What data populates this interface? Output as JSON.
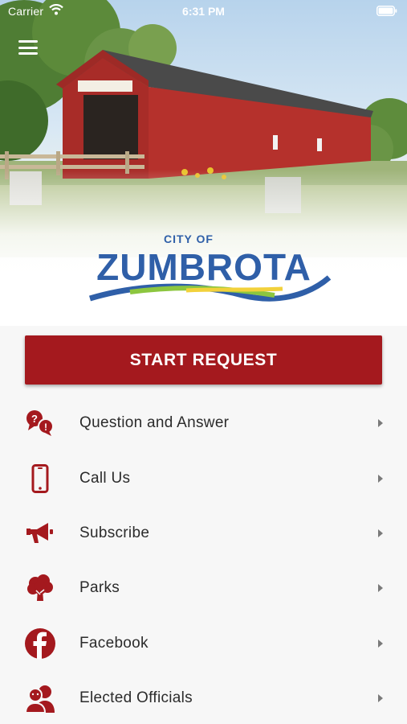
{
  "status_bar": {
    "carrier": "Carrier",
    "time": "6:31 PM"
  },
  "logo": {
    "line1": "CITY OF",
    "line2": "ZUMBROTA"
  },
  "actions": {
    "start_request": "START REQUEST"
  },
  "menu": {
    "items": [
      {
        "label": "Question and Answer",
        "icon": "question-answer-icon"
      },
      {
        "label": "Call Us",
        "icon": "phone-icon"
      },
      {
        "label": "Subscribe",
        "icon": "megaphone-icon"
      },
      {
        "label": "Parks",
        "icon": "tree-icon"
      },
      {
        "label": "Facebook",
        "icon": "facebook-icon"
      },
      {
        "label": "Elected Officials",
        "icon": "officials-icon"
      }
    ]
  },
  "colors": {
    "brand_red": "#a4191e",
    "logo_blue": "#2f5fa8",
    "logo_green": "#8cc63f",
    "logo_yellow": "#f2d13b"
  }
}
